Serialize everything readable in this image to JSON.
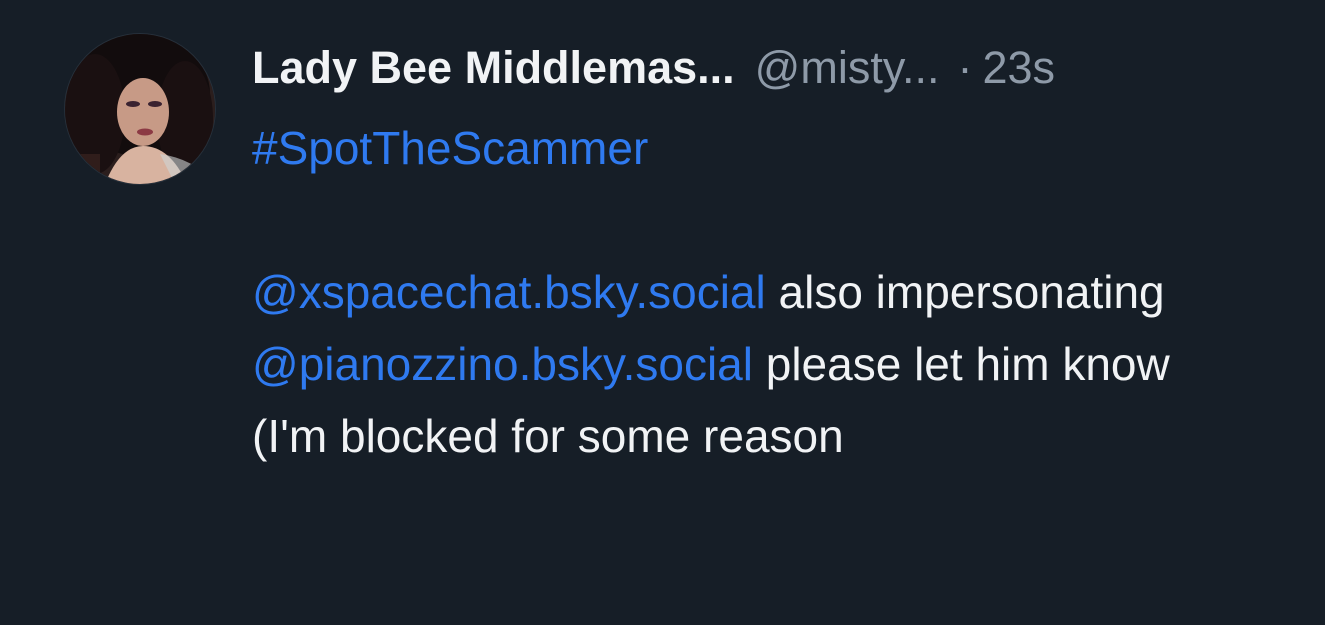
{
  "post": {
    "author": {
      "display_name": "Lady Bee Middlemas...",
      "handle": "@misty...",
      "separator": "·",
      "timestamp": "23s"
    },
    "body": {
      "hashtag": "#SpotTheScammer",
      "mention_1": "@xspacechat.bsky.social",
      "text_1": " also impersonating ",
      "mention_2": "@pianozzino.bsky.social",
      "text_2": " please let him know (I'm blocked for some reason"
    }
  },
  "colors": {
    "background": "#161e27",
    "text": "#f1f3f5",
    "muted": "#8e9aa8",
    "link": "#2f7af0"
  }
}
